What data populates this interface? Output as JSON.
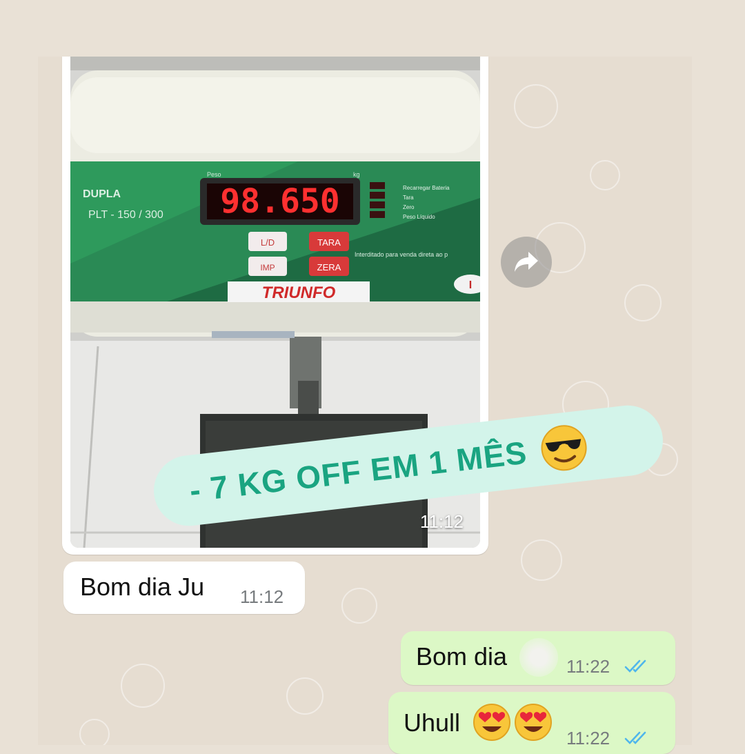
{
  "photo": {
    "brand": "TRIUNFO",
    "model_line1": "DUPLA",
    "model_line2": "PLT - 150 / 300",
    "display_value": "98.650",
    "display_label_left": "Peso",
    "display_label_right": "kg",
    "btn_ld": "L/D",
    "btn_tara": "TARA",
    "btn_imp": "IMP",
    "btn_zera": "ZERA",
    "side_labels": [
      "Recarregar Bateria",
      "Tara",
      "Zero",
      "Peso Líquido"
    ],
    "notice": "Interditado para venda direta ao p",
    "timestamp": "11:12"
  },
  "banner": {
    "text": "- 7 KG OFF EM 1 MÊS",
    "emoji": "smiling-face-with-sunglasses"
  },
  "messages": [
    {
      "direction": "incoming",
      "text": "Bom dia Ju",
      "time": "11:12"
    },
    {
      "direction": "outgoing",
      "text": "Bom dia",
      "time": "11:22",
      "status": "read"
    },
    {
      "direction": "outgoing",
      "text": "Uhull",
      "emojis": [
        "heart-eyes",
        "heart-eyes"
      ],
      "time": "11:22",
      "status": "read"
    }
  ],
  "colors": {
    "outgoing_bubble": "#dcf8c6",
    "incoming_bubble": "#ffffff",
    "banner_bg": "#d3f4ea",
    "banner_text": "#1aa481",
    "read_ticks": "#4fb6ec",
    "scale_green": "#1e6b43",
    "display_red": "#ff3030"
  }
}
